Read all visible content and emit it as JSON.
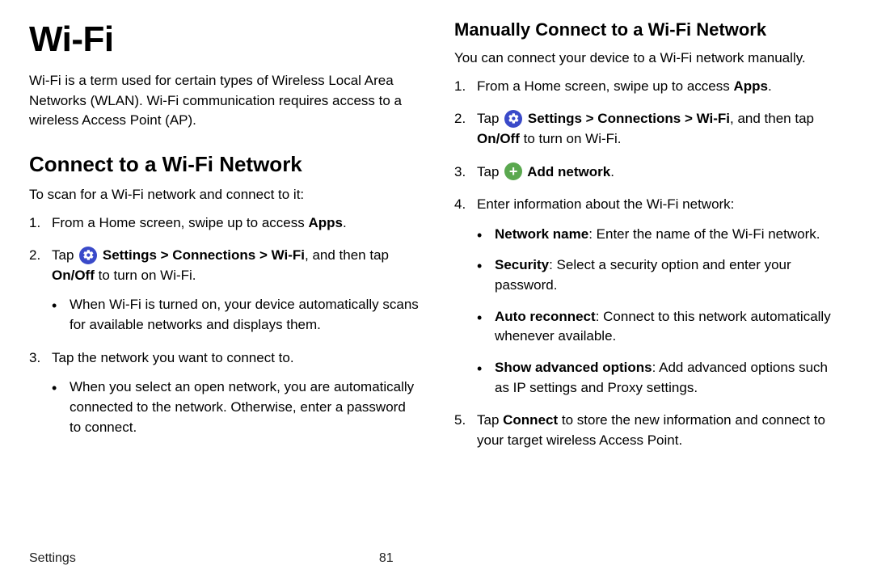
{
  "footer": {
    "section": "Settings",
    "page": "81"
  },
  "left": {
    "title": "Wi-Fi",
    "intro": "Wi-Fi is a term used for certain types of Wireless Local Area Networks (WLAN). Wi-Fi communication requires access to a wireless Access Point (AP).",
    "h2": "Connect to a Wi-Fi Network",
    "lead": "To scan for a Wi-Fi network and connect to it:",
    "step1_a": "From a Home screen, swipe up to access ",
    "step1_b": "Apps",
    "step1_c": ".",
    "step2_a": "Tap ",
    "step2_b": " Settings > Connections > Wi-Fi",
    "step2_c": ", and then tap ",
    "step2_d": "On/Off",
    "step2_e": " to turn on Wi-Fi.",
    "step2_bullet": "When Wi-Fi is turned on, your device automatically scans for available networks and displays them.",
    "step3": "Tap the network you want to connect to.",
    "step3_bullet": "When you select an open network, you are automatically connected to the network. Otherwise, enter a password to connect."
  },
  "right": {
    "h3": "Manually Connect to a Wi-Fi Network",
    "lead": "You can connect your device to a Wi-Fi network manually.",
    "step1_a": "From a Home screen, swipe up to access ",
    "step1_b": "Apps",
    "step1_c": ".",
    "step2_a": "Tap ",
    "step2_b": " Settings > Connections > Wi-Fi",
    "step2_c": ", and then tap ",
    "step2_d": "On/Off",
    "step2_e": " to turn on Wi-Fi.",
    "step3_a": "Tap ",
    "step3_b": " Add network",
    "step3_c": ".",
    "step4": "Enter information about the Wi-Fi network:",
    "b1_a": "Network name",
    "b1_b": ": Enter the name of the Wi-Fi network.",
    "b2_a": "Security",
    "b2_b": ": Select a security option and enter your password.",
    "b3_a": "Auto reconnect",
    "b3_b": ": Connect to this network automatically whenever available.",
    "b4_a": "Show advanced options",
    "b4_b": ": Add advanced options such as IP settings and Proxy settings.",
    "step5_a": "Tap ",
    "step5_b": "Connect",
    "step5_c": " to store the new information and connect to your target wireless Access Point."
  }
}
